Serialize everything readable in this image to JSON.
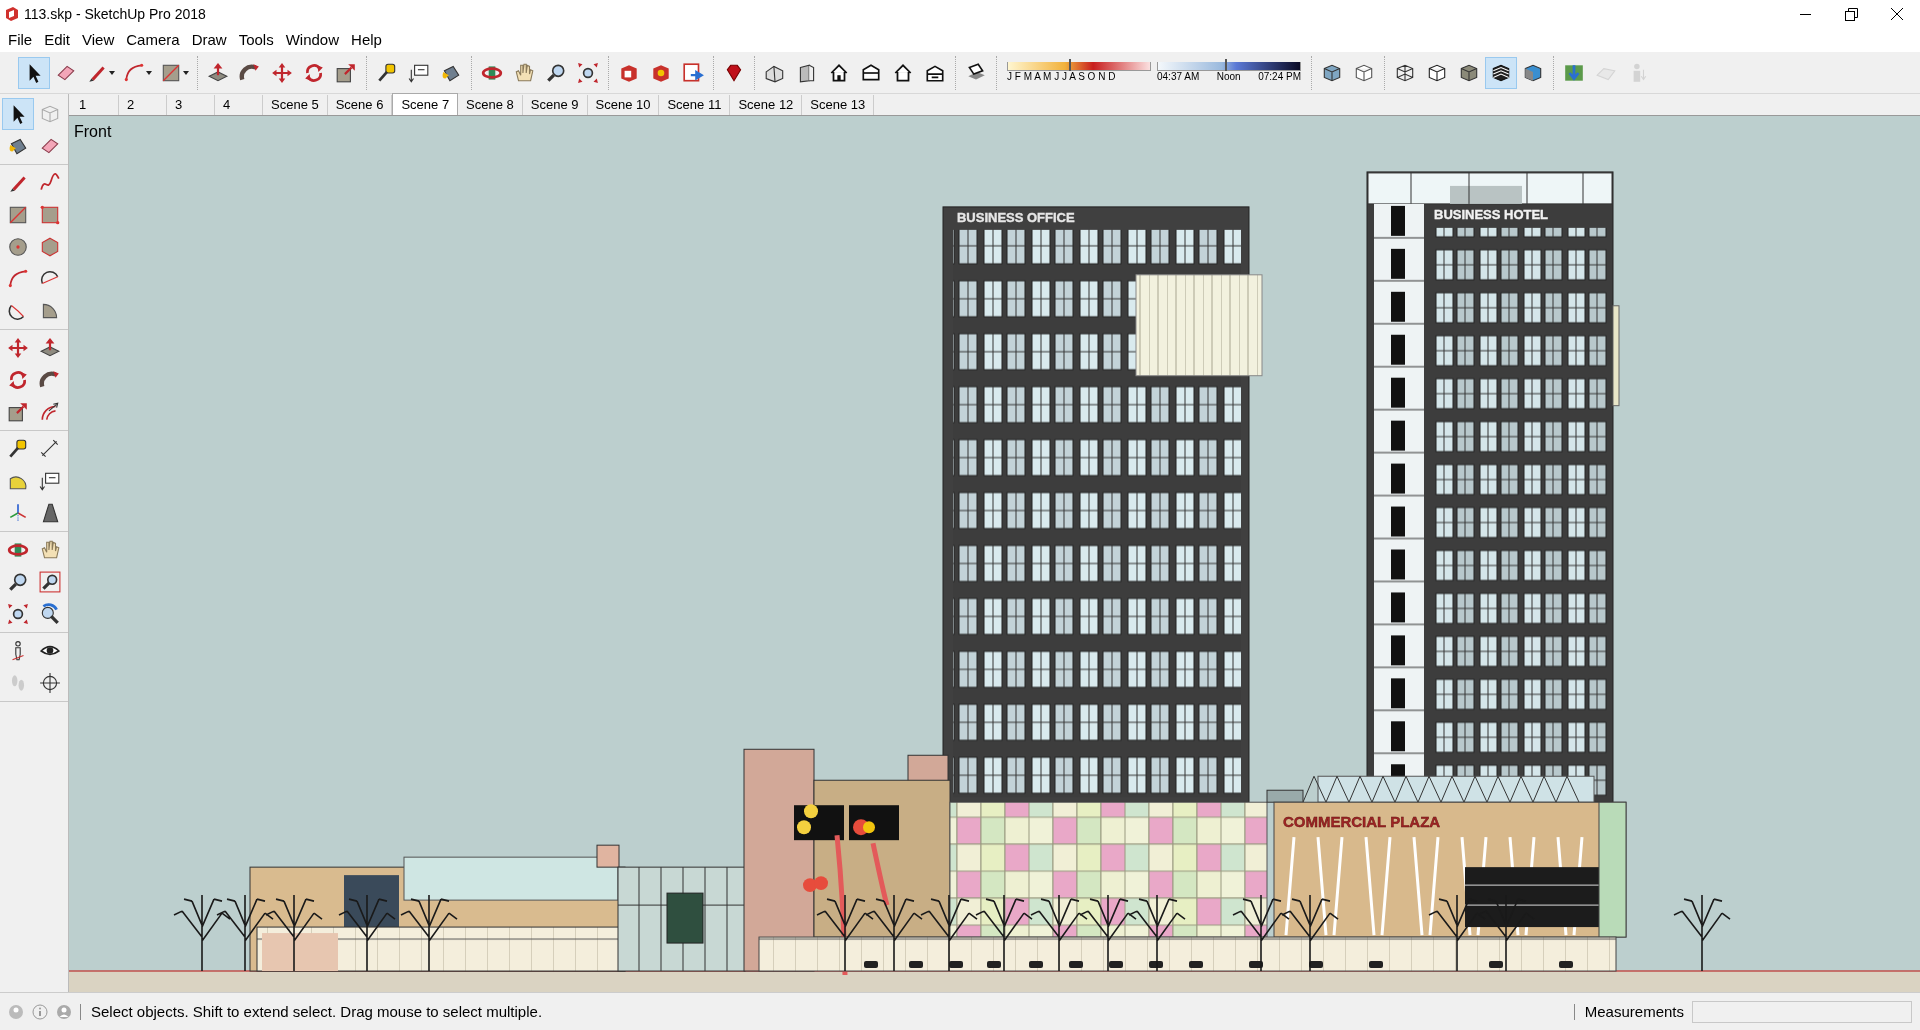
{
  "window": {
    "title": "113.skp - SketchUp Pro 2018"
  },
  "menu": [
    "File",
    "Edit",
    "View",
    "Camera",
    "Draw",
    "Tools",
    "Window",
    "Help"
  ],
  "toolbar": {
    "groups": [
      [
        {
          "selected": true,
          "disabled": false
        },
        {
          "selected": false,
          "disabled": false
        },
        {
          "selected": false,
          "disabled": false
        },
        {
          "selected": false,
          "disabled": false
        },
        {
          "selected": false,
          "disabled": false
        }
      ],
      [
        {
          "selected": false,
          "disabled": false
        },
        {
          "selected": false,
          "disabled": false
        },
        {
          "selected": false,
          "disabled": false
        },
        {
          "selected": false,
          "disabled": false
        },
        {
          "selected": false,
          "disabled": false
        }
      ],
      [
        {
          "selected": false,
          "disabled": false
        },
        {
          "selected": false,
          "disabled": false
        },
        {
          "selected": false,
          "disabled": false
        }
      ],
      [
        {
          "selected": false,
          "disabled": false
        },
        {
          "selected": false,
          "disabled": false
        },
        {
          "selected": false,
          "disabled": false
        },
        {
          "selected": false,
          "disabled": false
        }
      ],
      [
        {
          "selected": false,
          "disabled": false
        },
        {
          "selected": false,
          "disabled": false
        },
        {
          "selected": false,
          "disabled": false
        }
      ],
      [
        {
          "selected": false,
          "disabled": false
        }
      ],
      [
        {
          "selected": false,
          "disabled": false
        },
        {
          "selected": false,
          "disabled": false
        },
        {
          "selected": false,
          "disabled": false
        },
        {
          "selected": false,
          "disabled": false
        },
        {
          "selected": false,
          "disabled": false
        },
        {
          "selected": false,
          "disabled": false
        }
      ],
      [
        {
          "selected": false,
          "disabled": false
        }
      ]
    ],
    "shadow_settings": {
      "months": "J F M A M J J A S O N D",
      "month_slider": {
        "level": 0.43
      },
      "times": [
        "04:37 AM",
        "Noon",
        "07:24 PM"
      ],
      "time_slider": {
        "level": 0.47
      }
    },
    "style_groups": [
      [
        {
          "selected": false,
          "disabled": false
        },
        {
          "selected": false,
          "disabled": false
        }
      ],
      [
        {
          "selected": false,
          "disabled": false
        },
        {
          "selected": false,
          "disabled": false
        },
        {
          "selected": false,
          "disabled": false
        },
        {
          "selected": true,
          "disabled": false
        },
        {
          "selected": false,
          "disabled": false
        }
      ],
      [
        {
          "selected": false,
          "disabled": false
        },
        {
          "selected": false,
          "disabled": true
        },
        {
          "selected": false,
          "disabled": true
        }
      ]
    ]
  },
  "left_toolbar": {
    "groups": [
      [
        {
          "selected": true,
          "disabled": false
        },
        {
          "selected": false,
          "disabled": true
        },
        {
          "selected": false,
          "disabled": false
        },
        {
          "selected": false,
          "disabled": false
        }
      ],
      [
        {
          "selected": false,
          "disabled": false
        },
        {
          "selected": false,
          "disabled": false
        },
        {
          "selected": false,
          "disabled": false
        },
        {
          "selected": false,
          "disabled": false
        },
        {
          "selected": false,
          "disabled": false
        },
        {
          "selected": false,
          "disabled": false
        },
        {
          "selected": false,
          "disabled": false
        },
        {
          "selected": false,
          "disabled": false
        },
        {
          "selected": false,
          "disabled": false
        },
        {
          "selected": false,
          "disabled": false
        }
      ],
      [
        {
          "selected": false,
          "disabled": false
        },
        {
          "selected": false,
          "disabled": false
        },
        {
          "selected": false,
          "disabled": false
        },
        {
          "selected": false,
          "disabled": false
        },
        {
          "selected": false,
          "disabled": false
        },
        {
          "selected": false,
          "disabled": false
        }
      ],
      [
        {
          "selected": false,
          "disabled": false
        },
        {
          "selected": false,
          "disabled": false
        },
        {
          "selected": false,
          "disabled": false
        },
        {
          "selected": false,
          "disabled": false
        },
        {
          "selected": false,
          "disabled": false
        },
        {
          "selected": false,
          "disabled": false
        }
      ],
      [
        {
          "selected": false,
          "disabled": false
        },
        {
          "selected": false,
          "disabled": false
        },
        {
          "selected": false,
          "disabled": false
        },
        {
          "selected": false,
          "disabled": false
        },
        {
          "selected": false,
          "disabled": false
        },
        {
          "selected": false,
          "disabled": false
        }
      ],
      [
        {
          "selected": false,
          "disabled": false
        },
        {
          "selected": false,
          "disabled": false
        },
        {
          "selected": false,
          "disabled": true
        },
        {
          "selected": false,
          "disabled": false
        }
      ]
    ]
  },
  "scenes": [
    {
      "label": "1",
      "selected": false
    },
    {
      "label": "2",
      "selected": false
    },
    {
      "label": "3",
      "selected": false
    },
    {
      "label": "4",
      "selected": false
    },
    {
      "label": "Scene 5",
      "selected": false
    },
    {
      "label": "Scene 6",
      "selected": false
    },
    {
      "label": "Scene 7",
      "selected": true
    },
    {
      "label": "Scene 8",
      "selected": false
    },
    {
      "label": "Scene 9",
      "selected": false
    },
    {
      "label": "Scene 10",
      "selected": false
    },
    {
      "label": "Scene 11",
      "selected": false
    },
    {
      "label": "Scene 12",
      "selected": false
    },
    {
      "label": "Scene 13",
      "selected": false
    }
  ],
  "viewport": {
    "view_label": "Front",
    "signs": [
      "BUSINESS OFFICE",
      "BUSINESS HOTEL",
      "COMMERCIAL PLAZA"
    ]
  },
  "status_bar": {
    "message": "Select objects. Shift to extend select. Drag mouse to select multiple.",
    "measurements_label": "Measurements"
  }
}
